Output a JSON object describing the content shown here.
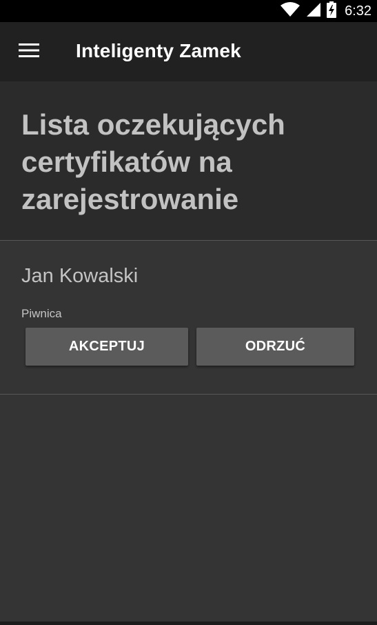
{
  "status_bar": {
    "time": "6:32",
    "icons": [
      "wifi-icon",
      "signal-icon",
      "battery-charging-icon"
    ]
  },
  "app_bar": {
    "menu_icon": "hamburger-menu-icon",
    "title": "Inteligenty Zamek"
  },
  "page": {
    "title": "Lista oczekujących certyfikatów na zarejestrowanie"
  },
  "requests": [
    {
      "name": "Jan Kowalski",
      "location": "Piwnica",
      "accept_label": "AKCEPTUJ",
      "reject_label": "ODRZUĆ"
    }
  ],
  "colors": {
    "status_bar": "#000000",
    "app_bar": "#212121",
    "header_background": "#2b2b2b",
    "body_background": "#343434",
    "title_text": "#c2c2c2",
    "button_background": "#5b5b5c",
    "button_text": "#ffffff"
  }
}
